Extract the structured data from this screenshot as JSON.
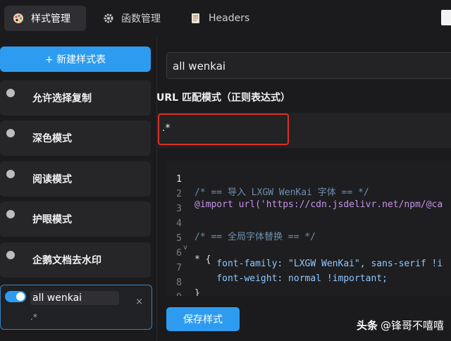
{
  "nav": {
    "tabs": [
      {
        "label": "样式管理",
        "icon": "palette-icon",
        "active": true
      },
      {
        "label": "函数管理",
        "icon": "gear-icon",
        "active": false
      },
      {
        "label": "Headers",
        "icon": "document-icon",
        "active": false
      }
    ]
  },
  "sidebar": {
    "new_button": "+ 新建样式表",
    "items": [
      {
        "label": "允许选择复制",
        "enabled": false
      },
      {
        "label": "深色模式",
        "enabled": false
      },
      {
        "label": "阅读模式",
        "enabled": false
      },
      {
        "label": "护眼模式",
        "enabled": false
      },
      {
        "label": "企鹅文档去水印",
        "enabled": false
      }
    ],
    "editing_item": {
      "name": "all wenkai",
      "pattern": ".*",
      "enabled": true,
      "close": "×"
    }
  },
  "main": {
    "title_value": "all wenkai",
    "url_label": "URL 匹配模式（正则表达式）",
    "url_value": ".*",
    "code_lines": [
      {
        "n": "1",
        "fold": "",
        "text": "/* == 导入 LXGW WenKai 字体 == */"
      },
      {
        "n": "2",
        "fold": "",
        "text": "@import url('https://cdn.jsdelivr.net/npm/@ca"
      },
      {
        "n": "3",
        "fold": "",
        "text": ""
      },
      {
        "n": "4",
        "fold": "",
        "text": "/* == 全局字体替换 == */"
      },
      {
        "n": "5",
        "fold": "v",
        "text": "* {"
      },
      {
        "n": "6",
        "fold": "",
        "text": "    font-family: \"LXGW WenKai\", sans-serif !i"
      },
      {
        "n": "7",
        "fold": "",
        "text": "    font-weight: normal !important;"
      },
      {
        "n": "8",
        "fold": "",
        "text": "}"
      },
      {
        "n": "9",
        "fold": "",
        "text": ""
      }
    ],
    "save_button": "保存样式"
  },
  "watermark": {
    "brand": "头条",
    "handle": "@锋哥不嘻嘻"
  },
  "colors": {
    "accent": "#2d9cf0",
    "background": "#1b1b1d",
    "highlight": "#d93025"
  }
}
